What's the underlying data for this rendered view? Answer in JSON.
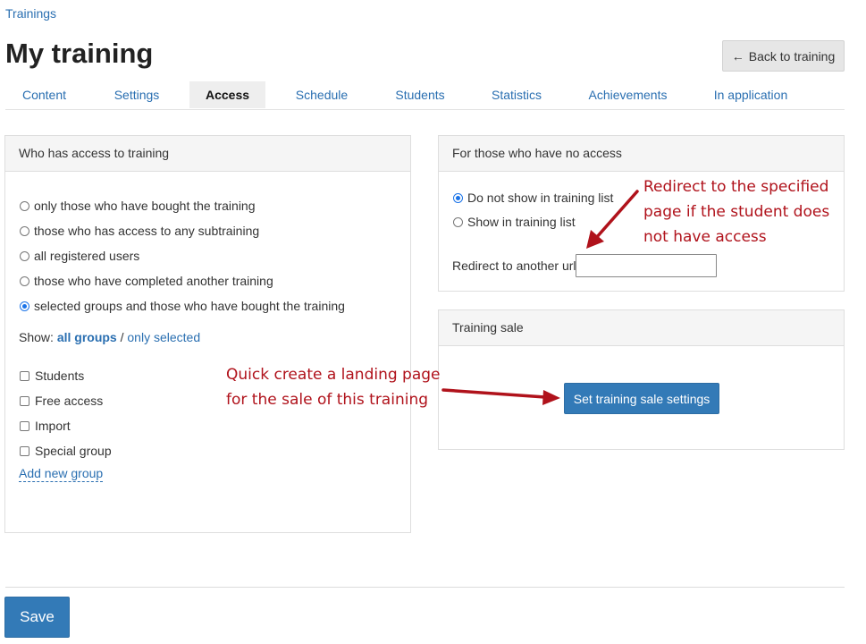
{
  "breadcrumb": "Trainings",
  "title": "My training",
  "back_button": "Back to training",
  "tabs": [
    "Content",
    "Settings",
    "Access",
    "Schedule",
    "Students",
    "Statistics",
    "Achievements",
    "In application"
  ],
  "active_tab": "Access",
  "access_panel": {
    "title": "Who has access to training",
    "options": [
      "only those who have bought the training",
      "those who has access to any subtraining",
      "all registered users",
      "those who have completed another training",
      "selected groups and those who have bought the training"
    ],
    "selected_option": 4,
    "show_label": "Show:",
    "show_all": "all groups",
    "show_separator": "/",
    "show_selected": "only selected",
    "groups": [
      "Students",
      "Free access",
      "Import",
      "Special group"
    ],
    "add_group": "Add new group"
  },
  "no_access_panel": {
    "title": "For those who have no access",
    "options": [
      "Do not show in training list",
      "Show in training list"
    ],
    "selected_option": 0,
    "redirect_label": "Redirect to another url",
    "redirect_value": ""
  },
  "sale_panel": {
    "title": "Training sale",
    "button": "Set training sale settings"
  },
  "annotations": {
    "redirect_note": [
      "Redirect to the specified",
      "page if the student does",
      "not have access"
    ],
    "sale_note": [
      "Quick create a landing page",
      "for the sale of this training"
    ]
  },
  "save_button": "Save",
  "colors": {
    "accent": "#337ab7",
    "link": "#2a6fb1",
    "annotation": "#b0121b",
    "radio_checked": "#1a73e8"
  }
}
